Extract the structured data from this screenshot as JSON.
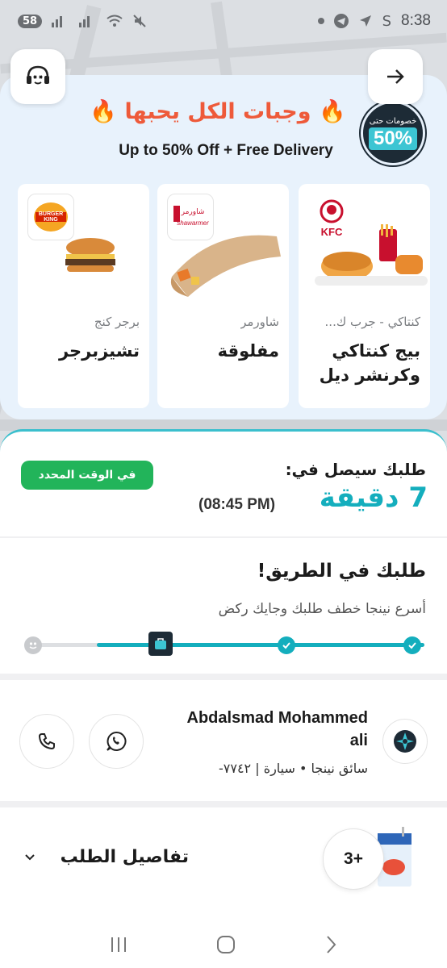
{
  "status_bar": {
    "notification_count": "58",
    "time": "8:38",
    "carrier_initial": "S"
  },
  "promo": {
    "title": "🔥 وجبات الكل يحبها 🔥",
    "subtitle": "Up to 50% Off + Free Delivery",
    "discount_label": "خصومات حتى",
    "discount_value": "50%",
    "offers": [
      {
        "brand": "كنتاكي - جرب ك...",
        "name": "بيج كنتاكي وكرنشر ديل",
        "logo_text": "KFC"
      },
      {
        "brand": "شاورمر",
        "name": "مفلوقة",
        "logo_text": "shawarmer"
      },
      {
        "brand": "برجر كنج",
        "name": "تشيزبرجر",
        "logo_text": "BURGER KING"
      }
    ]
  },
  "order": {
    "eta_label": "طلبك سيصل في:",
    "eta_value": "7 دقيقة",
    "eta_time": "(08:45 PM)",
    "on_time_badge": "في الوقت المحدد",
    "status_title": "طلبك في الطريق!",
    "status_subtitle": "أسرع نينجا خطف طلبك وجايك ركض",
    "progress_fraction": 0.66
  },
  "driver": {
    "name_line1": "Abdalsmad Mohammed",
    "name_line2": "ali",
    "meta": "سائق نينجا • سيارة | ٧٧٤٢-"
  },
  "details": {
    "title": "تفاصيل الطلب",
    "items_count": "3+"
  },
  "colors": {
    "accent": "#14aebd",
    "promo_title": "#ee5a3a",
    "badge_green": "#22b45a"
  }
}
